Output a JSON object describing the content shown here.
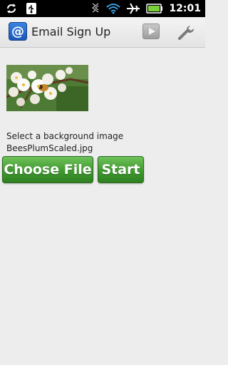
{
  "status_bar": {
    "time": "12:01",
    "icons": [
      "sync-icon",
      "usb-icon",
      "bluetooth-icon",
      "wifi-icon",
      "airplane-icon",
      "battery-icon"
    ]
  },
  "action_bar": {
    "app_icon_glyph": "@",
    "title": "Email Sign Up",
    "actions": [
      "play-icon",
      "wrench-icon"
    ]
  },
  "content": {
    "prompt": "Select a background image",
    "file_name": "BeesPlumScaled.jpg",
    "choose_button": "Choose File",
    "start_button": "Start"
  },
  "colors": {
    "button_green": "#3f9a2e",
    "background": "#ededed",
    "status_bar": "#000000",
    "battery": "#7ad13a",
    "wifi": "#3aa0e0"
  }
}
